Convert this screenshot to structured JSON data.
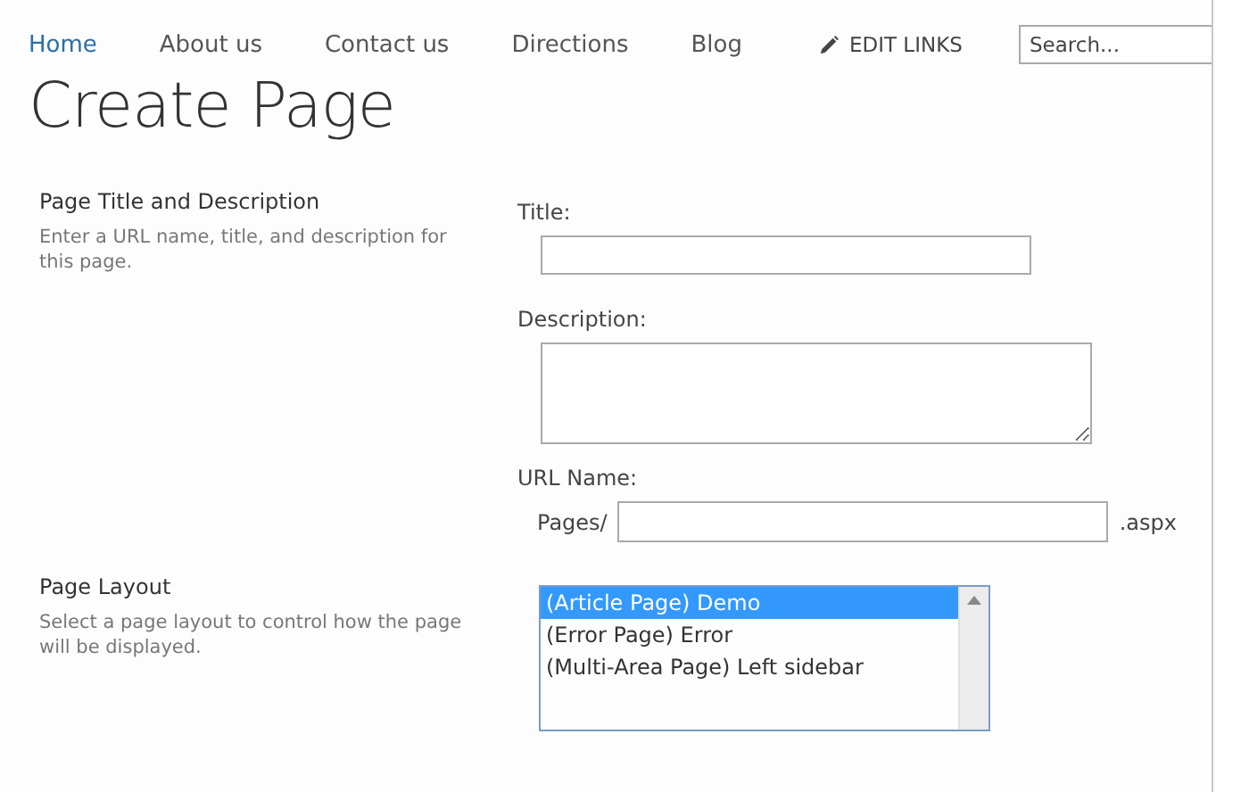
{
  "nav": {
    "items": [
      {
        "label": "Home",
        "selected": true
      },
      {
        "label": "About us",
        "selected": false
      },
      {
        "label": "Contact us",
        "selected": false
      },
      {
        "label": "Directions",
        "selected": false
      },
      {
        "label": "Blog",
        "selected": false
      }
    ],
    "edit_links": "EDIT LINKS",
    "search": {
      "placeholder": "Search..."
    }
  },
  "page_title": "Create Page",
  "sections": [
    {
      "heading": "Page Title and Description",
      "description": "Enter a URL name, title, and description for this page.",
      "fields": [
        {
          "kind": "text",
          "label": "Title:"
        },
        {
          "kind": "textarea",
          "label": "Description:"
        },
        {
          "kind": "url",
          "label": "URL Name:",
          "prefix": "Pages/",
          "suffix": ".aspx"
        }
      ]
    },
    {
      "heading": "Page Layout",
      "description": "Select a page layout to control how the page will be displayed.",
      "fields": [
        {
          "kind": "list",
          "options": [
            {
              "label": "(Article Page) Demo",
              "selected": true
            },
            {
              "label": "(Error Page) Error",
              "selected": false
            },
            {
              "label": "(Multi-Area Page) Left sidebar",
              "selected": false
            }
          ]
        }
      ]
    }
  ]
}
